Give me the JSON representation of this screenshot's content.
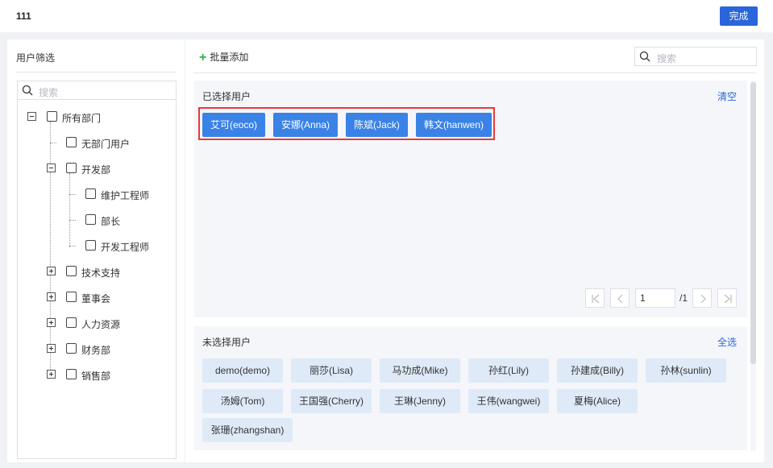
{
  "header": {
    "title": "111",
    "done_label": "完成"
  },
  "left": {
    "title": "用户筛选",
    "search_placeholder": "搜索",
    "tree": {
      "root": "所有部门",
      "no_dept": "无部门用户",
      "dev": "开发部",
      "dev_children": [
        "维护工程师",
        "部长",
        "开发工程师"
      ],
      "others": [
        "技术支持",
        "董事会",
        "人力资源",
        "财务部",
        "销售部"
      ]
    }
  },
  "right": {
    "batch_add": "批量添加",
    "search_placeholder": "搜索",
    "selected": {
      "title": "已选择用户",
      "clear": "清空",
      "users": [
        "艾可(eoco)",
        "安娜(Anna)",
        "陈斌(Jack)",
        "韩文(hanwen)"
      ],
      "pagination": {
        "page": "1",
        "total": "/1"
      }
    },
    "unselected": {
      "title": "未选择用户",
      "select_all": "全选",
      "users": [
        "demo(demo)",
        "丽莎(Lisa)",
        "马功成(Mike)",
        "孙红(Lily)",
        "孙建成(Billy)",
        "孙林(sunlin)",
        "汤姆(Tom)",
        "王国强(Cherry)",
        "王琳(Jenny)",
        "王伟(wangwei)",
        "夏梅(Alice)",
        "张珊(zhangshan)"
      ]
    }
  },
  "colors": {
    "primary": "#2a65d9",
    "chip_selected": "#3b82e6",
    "chip_unselected": "#dfeaf8",
    "highlight": "#e8393a",
    "add_icon": "#2bb24c"
  }
}
